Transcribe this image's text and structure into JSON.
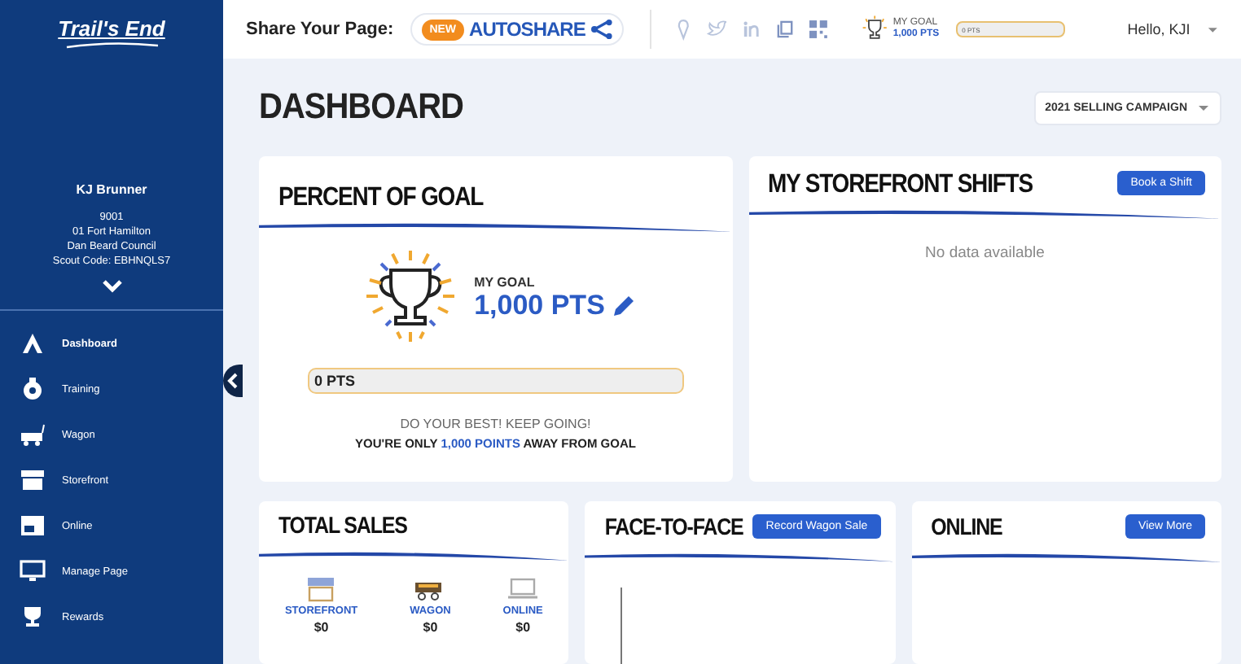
{
  "sidebar": {
    "logo": "Trail's End",
    "profile": {
      "name": "KJ Brunner",
      "lines": [
        "9001",
        "01 Fort Hamilton",
        "Dan Beard Council",
        "Scout Code: EBHNQLS7"
      ]
    },
    "items": [
      {
        "label": "Dashboard",
        "kind": "tent",
        "selected": true
      },
      {
        "label": "Training",
        "kind": "badge",
        "selected": false
      },
      {
        "label": "Wagon",
        "kind": "wagon",
        "selected": false
      },
      {
        "label": "Storefront",
        "kind": "store",
        "selected": false
      },
      {
        "label": "Online",
        "kind": "online",
        "selected": false
      },
      {
        "label": "Manage Page",
        "kind": "monitor",
        "selected": false
      },
      {
        "label": "Rewards",
        "kind": "trophy",
        "selected": false
      }
    ]
  },
  "topbar": {
    "share_label": "Share Your Page:",
    "autoshare": {
      "badge": "NEW",
      "label": "AUTOSHARE"
    },
    "goal": {
      "label": "MY GOAL",
      "value": "1,000 PTS",
      "bar_text": "0 PTS",
      "level": 0
    },
    "greeting": "Hello, KJI"
  },
  "page": {
    "title": "DASHBOARD",
    "campaign": "2021 SELLING CAMPAIGN"
  },
  "goal_card": {
    "title": "PERCENT OF GOAL",
    "goal_label": "MY GOAL",
    "goal_value": "1,000 PTS",
    "progress_text": "0 PTS",
    "level": 0,
    "encourage": "DO YOUR BEST! KEEP GOING!",
    "remaining_prefix": "YOU'RE ONLY",
    "remaining_points": "1,000 POINTS",
    "remaining_suffix": "AWAY FROM GOAL"
  },
  "shifts_card": {
    "title": "MY STOREFRONT SHIFTS",
    "button": "Book a Shift",
    "empty": "No data available"
  },
  "total_sales": {
    "title": "TOTAL SALES",
    "items": [
      {
        "kind": "store",
        "label": "STOREFRONT",
        "value": "$0"
      },
      {
        "kind": "wagon",
        "label": "WAGON",
        "value": "$0"
      },
      {
        "kind": "online",
        "label": "ONLINE",
        "value": "$0"
      }
    ]
  },
  "face_card": {
    "title": "FACE-TO-FACE",
    "button": "Record Wagon Sale"
  },
  "online_card": {
    "title": "ONLINE",
    "button": "View More"
  }
}
